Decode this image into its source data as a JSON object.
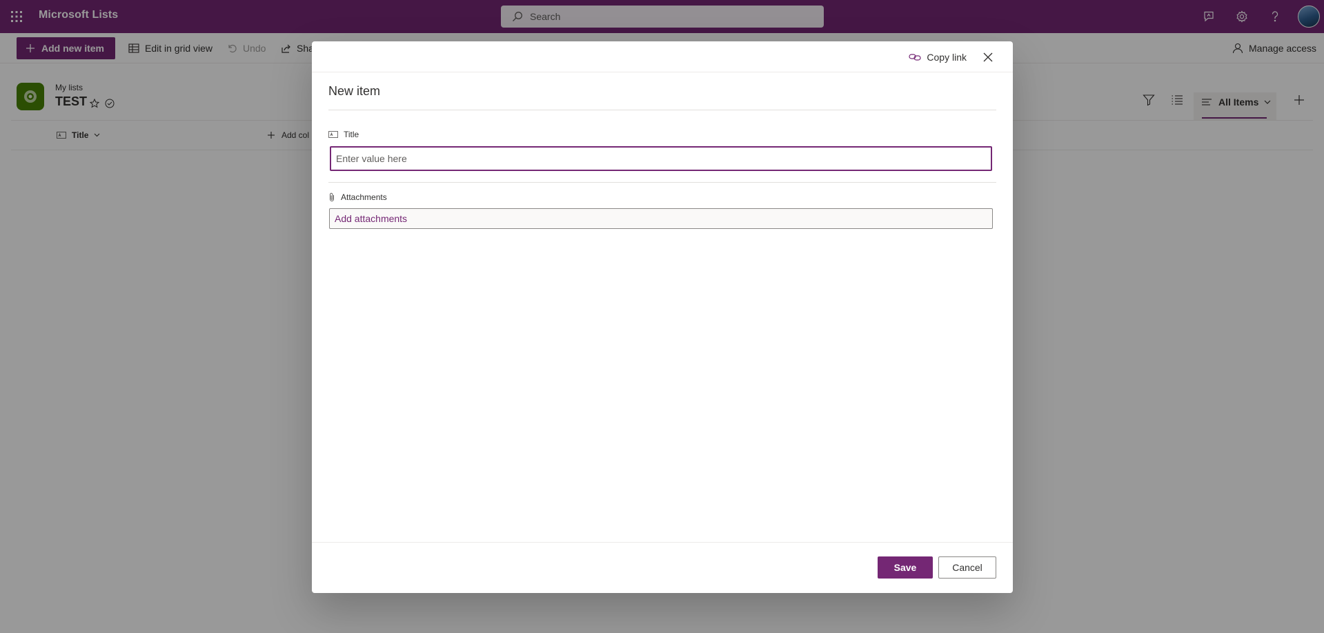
{
  "suite_bar": {
    "app_name": "Microsoft Lists",
    "search_placeholder": "Search",
    "brand_color": "#742774",
    "icons": [
      "waffle-icon",
      "search-icon",
      "feedback-icon",
      "gear-icon",
      "help-icon",
      "avatar"
    ]
  },
  "command_bar": {
    "add_new_item": "Add new item",
    "edit_grid": "Edit in grid view",
    "undo": "Undo",
    "share": "Sha",
    "manage_access": "Manage access"
  },
  "list": {
    "breadcrumb": "My lists",
    "title": "TEST",
    "view_name": "All Items",
    "columns": {
      "title": "Title",
      "add_column": "Add col"
    }
  },
  "dialog": {
    "copy_link": "Copy link",
    "heading": "New item",
    "fields": {
      "title_label": "Title",
      "title_placeholder": "Enter value here",
      "attachments_label": "Attachments",
      "attachments_action": "Add attachments"
    },
    "save": "Save",
    "cancel": "Cancel"
  }
}
